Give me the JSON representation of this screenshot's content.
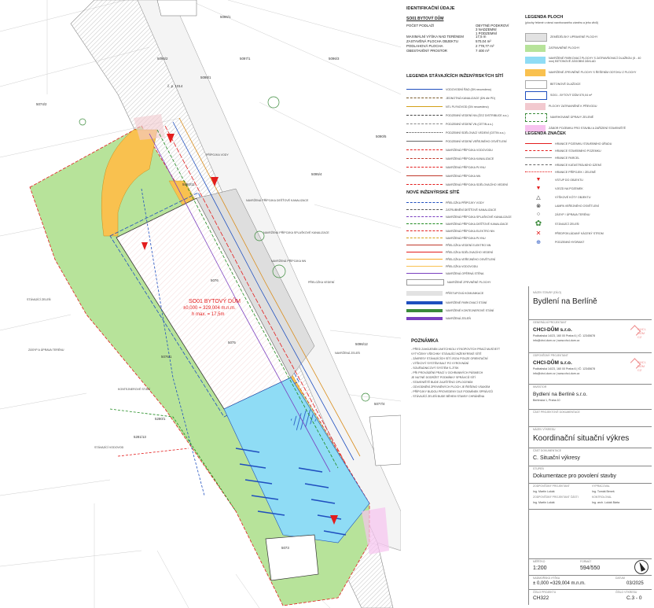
{
  "identification": {
    "title": "IDENTIFIKAČNÍ ÚDAJE",
    "building": "SO01 BYTOVÝ DŮM",
    "rows": [
      {
        "label": "POČET PODLAŽÍ",
        "value": "OBYTNÉ PODKROVÍ\n3 NADZEMNÍ\n1 PODZEMNÍ"
      },
      {
        "label": "MAXIMÁLNÍ VÝŠKA NAD TERÉNEM",
        "value": "17,5 m"
      },
      {
        "label": "ZASTAVĚNÁ PLOCHA OBJEKTU",
        "value": "570,04 m²"
      },
      {
        "label": "PODLAHOVÁ PLOCHA",
        "value": "2 778,77 m²"
      },
      {
        "label": "OBESTAVĚNÝ PROSTOR",
        "value": "7 400 m³"
      }
    ]
  },
  "legend_areas": {
    "title": "LEGENDA PLOCH",
    "subtitle": "(plochy řešené v rámci navrhovaného záměru a jeho vlivů)",
    "items": [
      {
        "label": "ZEMĚDĚLSKY UPRAVENÉ PLOCHY",
        "color": "#e2e2e2"
      },
      {
        "label": "ZATRAVNĚNÉ PLOCHY",
        "color": "#b7e39a"
      },
      {
        "label": "NAVRŽENÉ PARKOVACÍ PLOCHY S ZATRAVŇOVACÍ DLAŽBOU (5 - 40 mm) BETONOVÉ ZÁSOBNÍ ZÁKLAD",
        "color": "#8fdcf5"
      },
      {
        "label": "NAVRŽENÉ ZPEVNĚNÉ PLOCHY S ŘEŠENÍM ODTOKU Z PLOCHY",
        "color": "#f9c14f"
      },
      {
        "label": "BETONOVÉ DLAŽDICE",
        "color": "#ffffff"
      },
      {
        "label": "SO01 - BYTOVÝ DŮM 570,04 m²",
        "color": "#ffffff"
      },
      {
        "label": "PLOCHY ZATRAVNĚNÉ K PŘEVODU",
        "color": "#f2c9cf"
      },
      {
        "label": "NAVRHOVANÉ ÚPRAVY ZELENĚ",
        "color": "#ffffff"
      },
      {
        "label": "ZÁBOR POZEMKU PRO STAVBU A ZAŘÍZENÍ STAVENIŠTĚ",
        "color": "#f7c3ef"
      }
    ]
  },
  "legend_networks_existing": {
    "title": "LEGENDA STÁVAJÍCÍCH INŽENÝRSKÝCH SÍTÍ",
    "items": [
      "VODOVODNÍ ŘAD (DN neuvedeno)",
      "JEDNOTNÁ KANALIZACE (DN dle PD)",
      "NTL PLYNOVOD (DN neuvedeno)",
      "PODZEMNÍ VEDENÍ NN (ČEZ DISTRIBUCE a.s.)",
      "PODZEMNÍ VEDENÍ VN (CETIN a.s.)",
      "PODZEMNÍ SDĚLOVACÍ VEDENÍ (CETIN a.s.)",
      "PODZEMNÍ VEDENÍ VEŘEJNÉHO OSVĚTLENÍ",
      "NAVRŽENÁ PŘÍPOJKA VODOVODU",
      "NAVRŽENÁ PŘÍPOJKA KANALIZACE",
      "NAVRŽENÁ PŘÍPOJKA PLYNU",
      "NAVRŽENÁ PŘÍPOJKA NN",
      "NAVRŽENÁ PŘÍPOJKA SDĚLOVACÍHO VEDENÍ"
    ]
  },
  "legend_networks_new": {
    "title": "NOVÉ INŽENÝRSKÉ SÍTĚ",
    "items": [
      "PŘELOŽKA PŘÍPOJKY VODY",
      "ZATRUBNĚNÍ DEŠŤOVÉ KANALIZACE",
      "NAVRŽENÁ PŘÍPOJKA SPLAŠKOVÉ KANALIZACE",
      "NAVRŽENÁ PŘÍPOJKA DEŠŤOVÉ KANALIZACE",
      "NAVRŽENÁ PŘÍPOJKA ELEKTRO NN",
      "NAVRŽENÁ PŘÍPOJKA PLYNU",
      "PŘELOŽKA VEDENÍ ELEKTRO NN",
      "PŘELOŽKA SDĚLOVACÍHO VEDENÍ",
      "PŘELOŽKA VEŘEJNÉHO OSVĚTLENÍ",
      "PŘELOŽKA VODOVODU",
      "NAVRŽENÁ OPĚRNÁ STĚNA",
      "NAVRŽENÉ ZPEVNĚNÉ PLOCHY",
      "PŘÍSTUPOVÁ KOMUNIKACE",
      "NAVRŽENÉ PARKOVACÍ STÁNÍ",
      "NAVRŽENÉ KONTEJNEROVÉ STÁNÍ",
      "NAVRŽENÁ ZELEŇ"
    ]
  },
  "legend_marks": {
    "title": "LEGENDA ZNAČEK",
    "items": [
      "HRANICE POZEMKU STAVEBNÍHO ÚŘADU",
      "HRANICE STAVEBNÍHO POZEMKU",
      "HRANICE PARCEL",
      "HRANICE KATASTRÁLNÍHO ÚZEMÍ",
      "HRANICE PŘÍPOJEK / ZELENĚ",
      "VSTUP DO OBJEKTU",
      "VJEZD NA POZEMEK",
      "VÝŠKOVÉ KÓTY OBJEKTU",
      "LAMPA VEŘEJNÉHO OSVĚTLENÍ",
      "ZÁSYP / ÚPRAVA TERÉNU",
      "STÁVAJÍCÍ ZELEŇ",
      "PŘEDPOKLÁDANÝ KÁCENÝ STROM",
      "PODZEMNÍ HYDRANT"
    ]
  },
  "note": {
    "title": "POZNÁMKA",
    "lines": [
      "- PŘED ZAHÁJENÍM JAKÝCHKOLI VÝKOPOVÝCH PRACÍ MUSÍ BÝT",
      "  VYTYČENY VŠECHNY STÁVAJÍCÍ INŽENÝRSKÉ SÍTĚ",
      "- ZÁKRESY STÁVAJÍCÍCH SÍTÍ JSOU POUZE ORIENTAČNÍ",
      "- VÝŠKOVÝ SYSTÉM BALT PO VYROVNÁNÍ",
      "- SOUŘADNICOVÝ SYSTÉM S-JTSK",
      "- PŘI PROVÁDĚNÍ PRACÍ V OCHRANNÝCH PÁSMECH",
      "  JE NUTNÉ DODRŽET PODMÍNKY SPRÁVCŮ SÍTÍ",
      "- STAVENIŠTĚ BUDE ZAJIŠTĚNO OPLOCENÍM",
      "- ODVODNĚNÍ ZPEVNĚNÝCH PLOCH JE ŘEŠENO VSAKEM",
      "- PŘÍPOJKY BUDOU PROVEDENY DLE PODMÍNEK SPRÁVCŮ",
      "- STÁVAJÍCÍ ZELEŇ BUDE BĚHEM STAVBY CHRÁNĚNA"
    ]
  },
  "title_block": {
    "name_label": "NÁZEV STAVBY (DÍLO)",
    "project_name": "Bydlení na Berlíně",
    "general_designer_label": "GENERÁLNÍ PROJEKTANT",
    "company": "CHCI-DŮM s.r.o.",
    "company_details": "Podbabská 14/23, 160 00 Praha 6 | IČ: 12345678",
    "company_contact": "info@chci-dum.cz | www.chci-dum.cz",
    "logo_text": [
      "CHCI-",
      "DŮM",
      "CZ"
    ],
    "responsible_label": "ODPOVĚDNÝ PROJEKTANT",
    "company2": "CHCI-DŮM s.r.o.",
    "company2_details": "Podbabská 14/23, 160 00 Praha 6 | IČ: 12345678",
    "company2_contact": "info@chci-dum.cz | www.chci-dum.cz",
    "investor_label": "INVESTOR",
    "investor": "Bydlení na Berlíně s.r.o.",
    "investor_details": "Berlínská 1, Praha 10",
    "part_label": "ČÁST PROJEKTOVÉ DOKUMENTACE",
    "drawing_label": "NÁZEV VÝKRESU",
    "drawing_name": "Koordinační situační výkres",
    "section_label": "ČÁST DOKUMENTACE",
    "section": "C. Situační výkresy",
    "degree_label": "STUPEŇ",
    "degree": "Dokumentace pro povolení stavby",
    "signatures": [
      {
        "role": "ZODPOVĚDNÝ PROJEKTANT",
        "name": "Ing. Martin Lukáš"
      },
      {
        "role": "VYPRACOVAL",
        "name": "Ing. Tomáš Beneš"
      },
      {
        "role": "ZODPOVĚDNÝ PROJEKTANT ČÁSTI",
        "name": "Ing. Martin Lukáš"
      },
      {
        "role": "KONTROLOVAL",
        "name": "Ing. arch. Lukáš Bárta"
      }
    ],
    "scale_label": "MĚŘÍTKO",
    "scale": "1:200",
    "format_label": "FORMÁT",
    "format": "594/550",
    "elevation_label": "NADMOŘSKÁ VÝŠKA",
    "elevation": "± 0,000 =329,004 m.n.m.",
    "date_label": "DATUM",
    "date": "03/2025",
    "number_label": "ČÍSLO PROJEKTU",
    "number": "CH322",
    "sheet_label": "ČÍSLO VÝKRESU",
    "sheet": "C.3 - 0"
  },
  "plan": {
    "building_label": "SO01 BYTOVÝ DŮM",
    "building_level": "±0,000 = 329,004 m.n.m.",
    "building_height": "h max. = 17,5m",
    "parcels": [
      "5098/1",
      "5097/1",
      "5096/3",
      "5096/2",
      "5096/1",
      "5090/5",
      "5095/4",
      "5074/2",
      "5090/11",
      "5076",
      "5075",
      "5096/12",
      "5077/4",
      "5280/1",
      "5281/13",
      "5073",
      "5076/1"
    ],
    "roads": [
      "č. p. 1014"
    ],
    "callouts": [
      "PŘÍPOJKA VODY",
      "NAVRŽENÁ PŘÍPOJKA DEŠŤOVÉ KANALIZACE",
      "NAVRŽENÁ PŘÍPOJKA SPLAŠKOVÉ KANALIZACE",
      "NAVRŽENÁ PŘÍPOJKA NN",
      "PŘELOŽKA VEDENÍ",
      "STÁVAJÍCÍ ZELEŇ",
      "ZÁSYP A ÚPRAVA TERÉNU",
      "KONTEJNEROVÉ STÁNÍ",
      "STÁVAJÍCÍ VODOVOD",
      "NAVRŽENÁ ZELEŇ"
    ]
  }
}
